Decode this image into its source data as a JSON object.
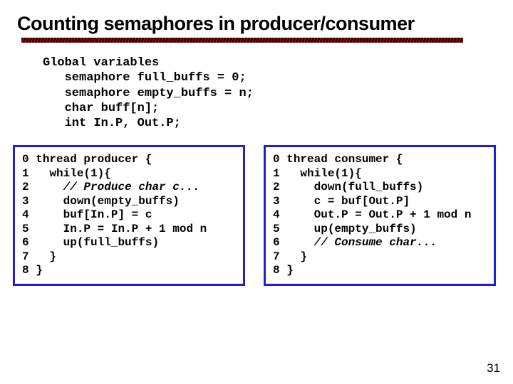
{
  "title": "Counting semaphores in producer/consumer",
  "globals": {
    "heading": "Global variables",
    "l1": "semaphore full_buffs = 0;",
    "l2": "semaphore empty_buffs = n;",
    "l3": "char buff[n];",
    "l4": "int In.P, Out.P;"
  },
  "producer": {
    "n0": "0",
    "l0": "thread producer {",
    "n1": "1",
    "l1": "while(1){",
    "n2": "2",
    "l2": "// Produce char c...",
    "n3": "3",
    "l3": "down(empty_buffs)",
    "n4": "4",
    "l4": "buf[In.P] = c",
    "n5": "5",
    "l5": "In.P = In.P + 1 mod n",
    "n6": "6",
    "l6": "up(full_buffs)",
    "n7": "7",
    "l7": "}",
    "n8": "8",
    "l8": "}"
  },
  "consumer": {
    "n0": "0",
    "l0": "thread consumer {",
    "n1": "1",
    "l1": "while(1){",
    "n2": "2",
    "l2": "down(full_buffs)",
    "n3": "3",
    "l3": "c = buf[Out.P]",
    "n4": "4",
    "l4": "Out.P = Out.P + 1 mod n",
    "n5": "5",
    "l5": "up(empty_buffs)",
    "n6": "6",
    "l6": "// Consume char...",
    "n7": "7",
    "l7": "}",
    "n8": "8",
    "l8": "}"
  },
  "page_number": "31"
}
